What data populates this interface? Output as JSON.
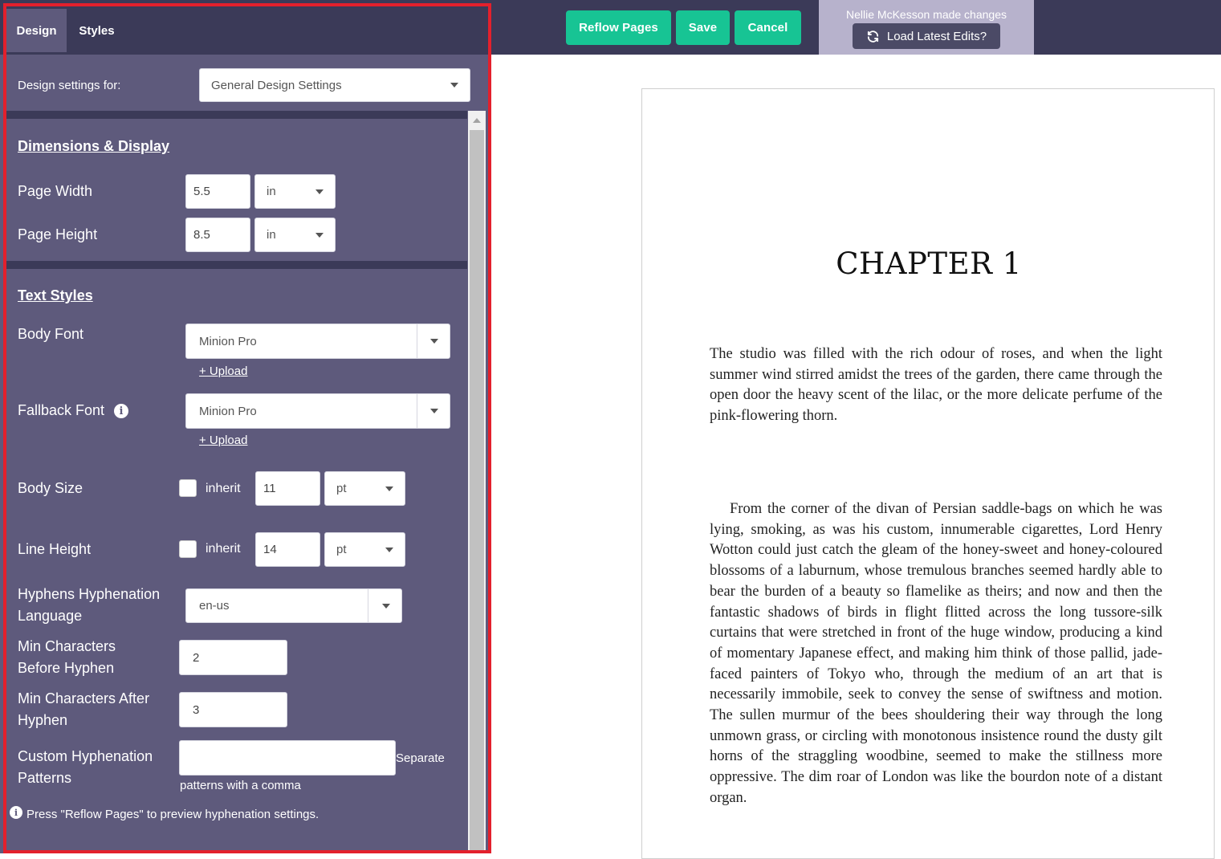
{
  "panel": {
    "tabs": [
      {
        "label": "Design"
      },
      {
        "label": "Styles"
      }
    ],
    "design_settings_for": {
      "label": "Design settings for:",
      "value": "General Design Settings"
    },
    "dimensions": {
      "heading": "Dimensions & Display",
      "page_width": {
        "label": "Page Width",
        "value": "5.5",
        "unit": "in"
      },
      "page_height": {
        "label": "Page Height",
        "value": "8.5",
        "unit": "in"
      }
    },
    "text_styles": {
      "heading": "Text Styles",
      "body_font": {
        "label": "Body Font",
        "value": "Minion Pro",
        "upload": "+ Upload"
      },
      "fallback_font": {
        "label": "Fallback Font",
        "value": "Minion Pro",
        "upload": "+ Upload",
        "info_icon": "info-icon"
      },
      "body_size": {
        "label": "Body Size",
        "inherit_label": "inherit",
        "inherit_checked": false,
        "value": "11",
        "unit": "pt"
      },
      "line_height": {
        "label": "Line Height",
        "inherit_label": "inherit",
        "inherit_checked": false,
        "value": "14",
        "unit": "pt"
      },
      "hyphenation_language": {
        "label_line1": "Hyphens Hyphenation",
        "label_line2": "Language",
        "value": "en-us"
      },
      "min_before": {
        "label_line1": "Min Characters",
        "label_line2": "Before Hyphen",
        "value": "2"
      },
      "min_after": {
        "label_line1": "Min Characters After",
        "label_line2": "Hyphen",
        "value": "3"
      },
      "custom_patterns": {
        "label_line1": "Custom Hyphenation",
        "label_line2": "Patterns",
        "value": "",
        "help_part1": "Separate",
        "help_part2": "patterns with a comma"
      },
      "reflow_note": "Press \"Reflow Pages\" to preview hyphenation settings."
    }
  },
  "toolbar": {
    "reflow_label": "Reflow Pages",
    "save_label": "Save",
    "cancel_label": "Cancel",
    "accent_color": "#17c494",
    "notice_text": "Nellie McKesson made changes",
    "load_edits_label": "Load Latest Edits?"
  },
  "preview": {
    "chapter_title": "CHAPTER 1",
    "paragraph1": "The studio was filled with the rich odour of roses, and when the light summer wind stirred amidst the trees of the garden, there came through the open door the heavy scent of the lilac, or the more deli­cate perfume of the pink-flowering thorn.",
    "paragraph2": "From the corner of the divan of Persian saddle-bags on which he was lying, smoking, as was his custom, innumerable cigarettes, Lord Henry Wotton could just catch the gleam of the honey-sweet and honey-coloured blossoms of a laburnum, whose tremulous branches seemed hardly able to bear the burden of a beauty so flamelike as theirs; and now and then the fantastic shadows of birds in flight flitted across the long tussore-silk curtains that were stretched in front of the huge window, producing a kind of momentary Japanese effect, and making him think of those pallid, jade-faced painters of Tokyo who, through the medium of an art that is necessarily immobile, seek to convey the sense of swiftness and motion. The sullen murmur of the bees shouldering their way through the long unmown grass, or cir­cling with monotonous insistence round the dusty gilt horns of the straggling woodbine, seemed to make the stillness more oppressive. The dim roar of London was like the bourdon note of a distant organ."
  },
  "colors": {
    "panel_bg": "#5e5a7c",
    "topbar_bg": "#3b3a58",
    "highlight_border": "#e3202c"
  }
}
